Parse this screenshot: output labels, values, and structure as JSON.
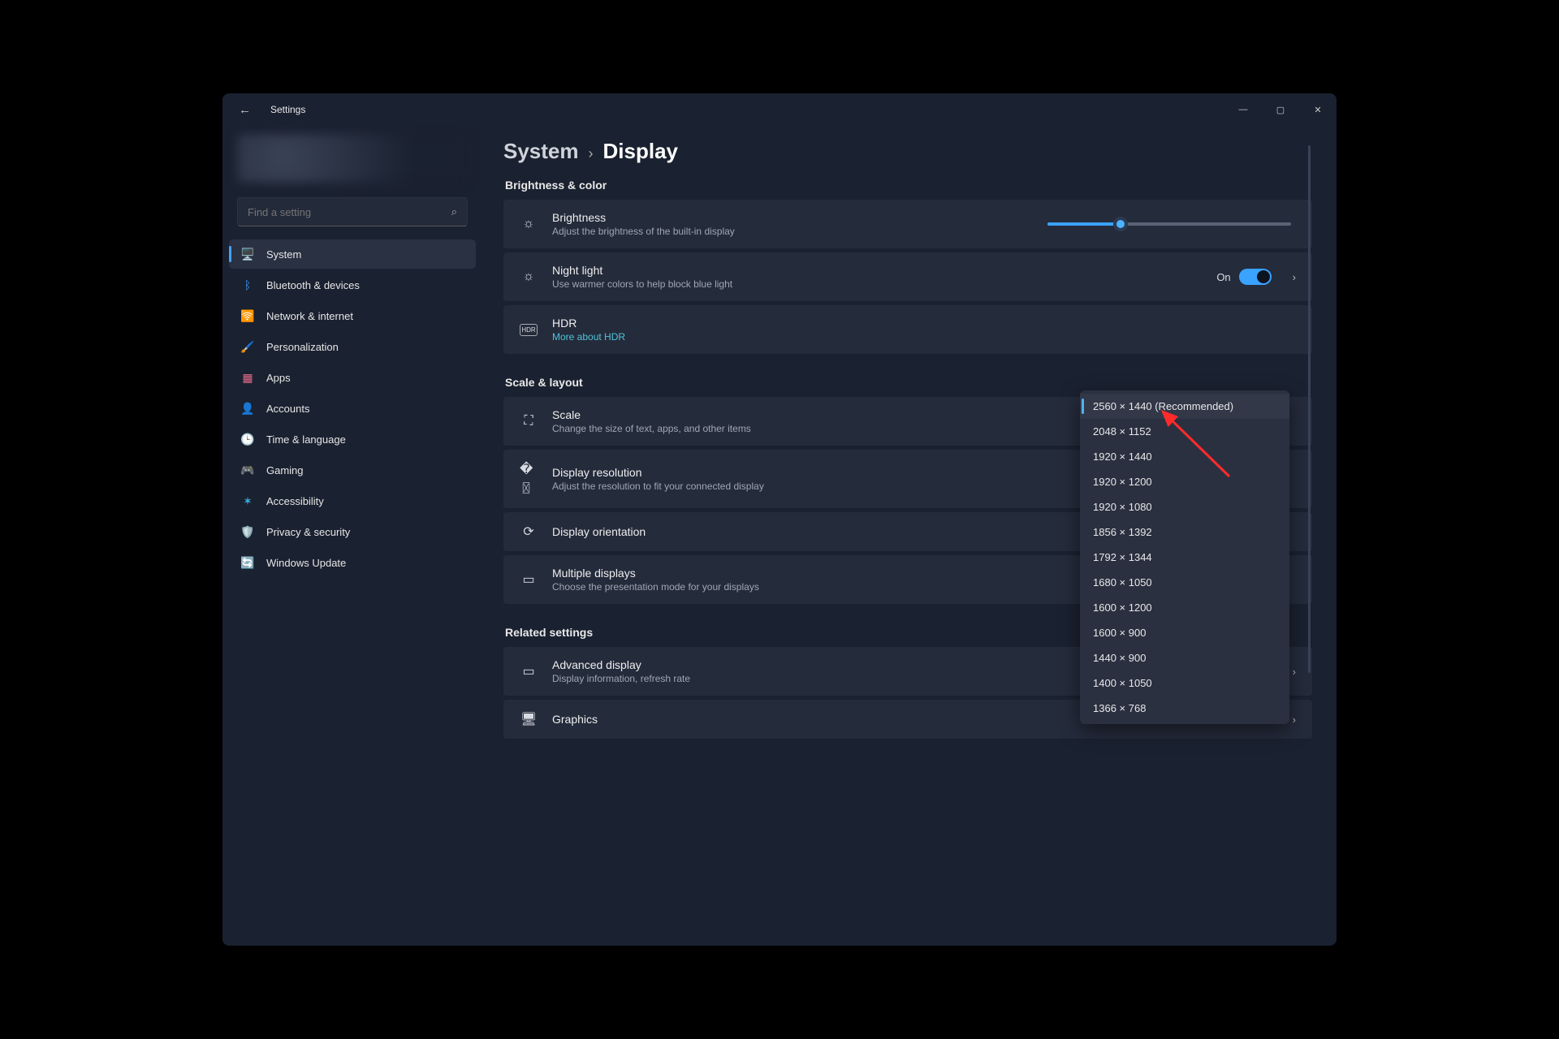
{
  "app_title": "Settings",
  "search_placeholder": "Find a setting",
  "sidebar": {
    "items": [
      {
        "label": "System",
        "icon": "🖥️",
        "color": "#4aa3ff"
      },
      {
        "label": "Bluetooth & devices",
        "icon": "ᛒ",
        "color": "#3a9bff"
      },
      {
        "label": "Network & internet",
        "icon": "🛜",
        "color": "#36b8e8"
      },
      {
        "label": "Personalization",
        "icon": "🖌️",
        "color": "#d88b3e"
      },
      {
        "label": "Apps",
        "icon": "▦",
        "color": "#e86c8a"
      },
      {
        "label": "Accounts",
        "icon": "👤",
        "color": "#3ab87a"
      },
      {
        "label": "Time & language",
        "icon": "🕒",
        "color": "#4a8cff"
      },
      {
        "label": "Gaming",
        "icon": "🎮",
        "color": "#cfd3da"
      },
      {
        "label": "Accessibility",
        "icon": "✶",
        "color": "#3ab0e8"
      },
      {
        "label": "Privacy & security",
        "icon": "🛡️",
        "color": "#9aa2b2"
      },
      {
        "label": "Windows Update",
        "icon": "🔄",
        "color": "#2aa7d4"
      }
    ],
    "selected_index": 0
  },
  "breadcrumb": {
    "parent": "System",
    "current": "Display"
  },
  "sections": {
    "brightness_color": "Brightness & color",
    "scale_layout": "Scale & layout",
    "related": "Related settings"
  },
  "cards": {
    "brightness": {
      "title": "Brightness",
      "subtitle": "Adjust the brightness of the built-in display",
      "value_pct": 30
    },
    "night_light": {
      "title": "Night light",
      "subtitle": "Use warmer colors to help block blue light",
      "state_label": "On",
      "state": true
    },
    "hdr": {
      "title": "HDR",
      "link": "More about HDR",
      "icon_text": "HDR"
    },
    "scale": {
      "title": "Scale",
      "subtitle": "Change the size of text, apps, and other items"
    },
    "resolution": {
      "title": "Display resolution",
      "subtitle": "Adjust the resolution to fit your connected display"
    },
    "orientation": {
      "title": "Display orientation"
    },
    "multiple": {
      "title": "Multiple displays",
      "subtitle": "Choose the presentation mode for your displays"
    },
    "advanced": {
      "title": "Advanced display",
      "subtitle": "Display information, refresh rate"
    },
    "graphics": {
      "title": "Graphics"
    }
  },
  "resolution_dropdown": {
    "selected": "2560 × 1440 (Recommended)",
    "options": [
      "2560 × 1440 (Recommended)",
      "2048 × 1152",
      "1920 × 1440",
      "1920 × 1200",
      "1920 × 1080",
      "1856 × 1392",
      "1792 × 1344",
      "1680 × 1050",
      "1600 × 1200",
      "1600 × 900",
      "1440 × 900",
      "1400 × 1050",
      "1366 × 768"
    ]
  }
}
